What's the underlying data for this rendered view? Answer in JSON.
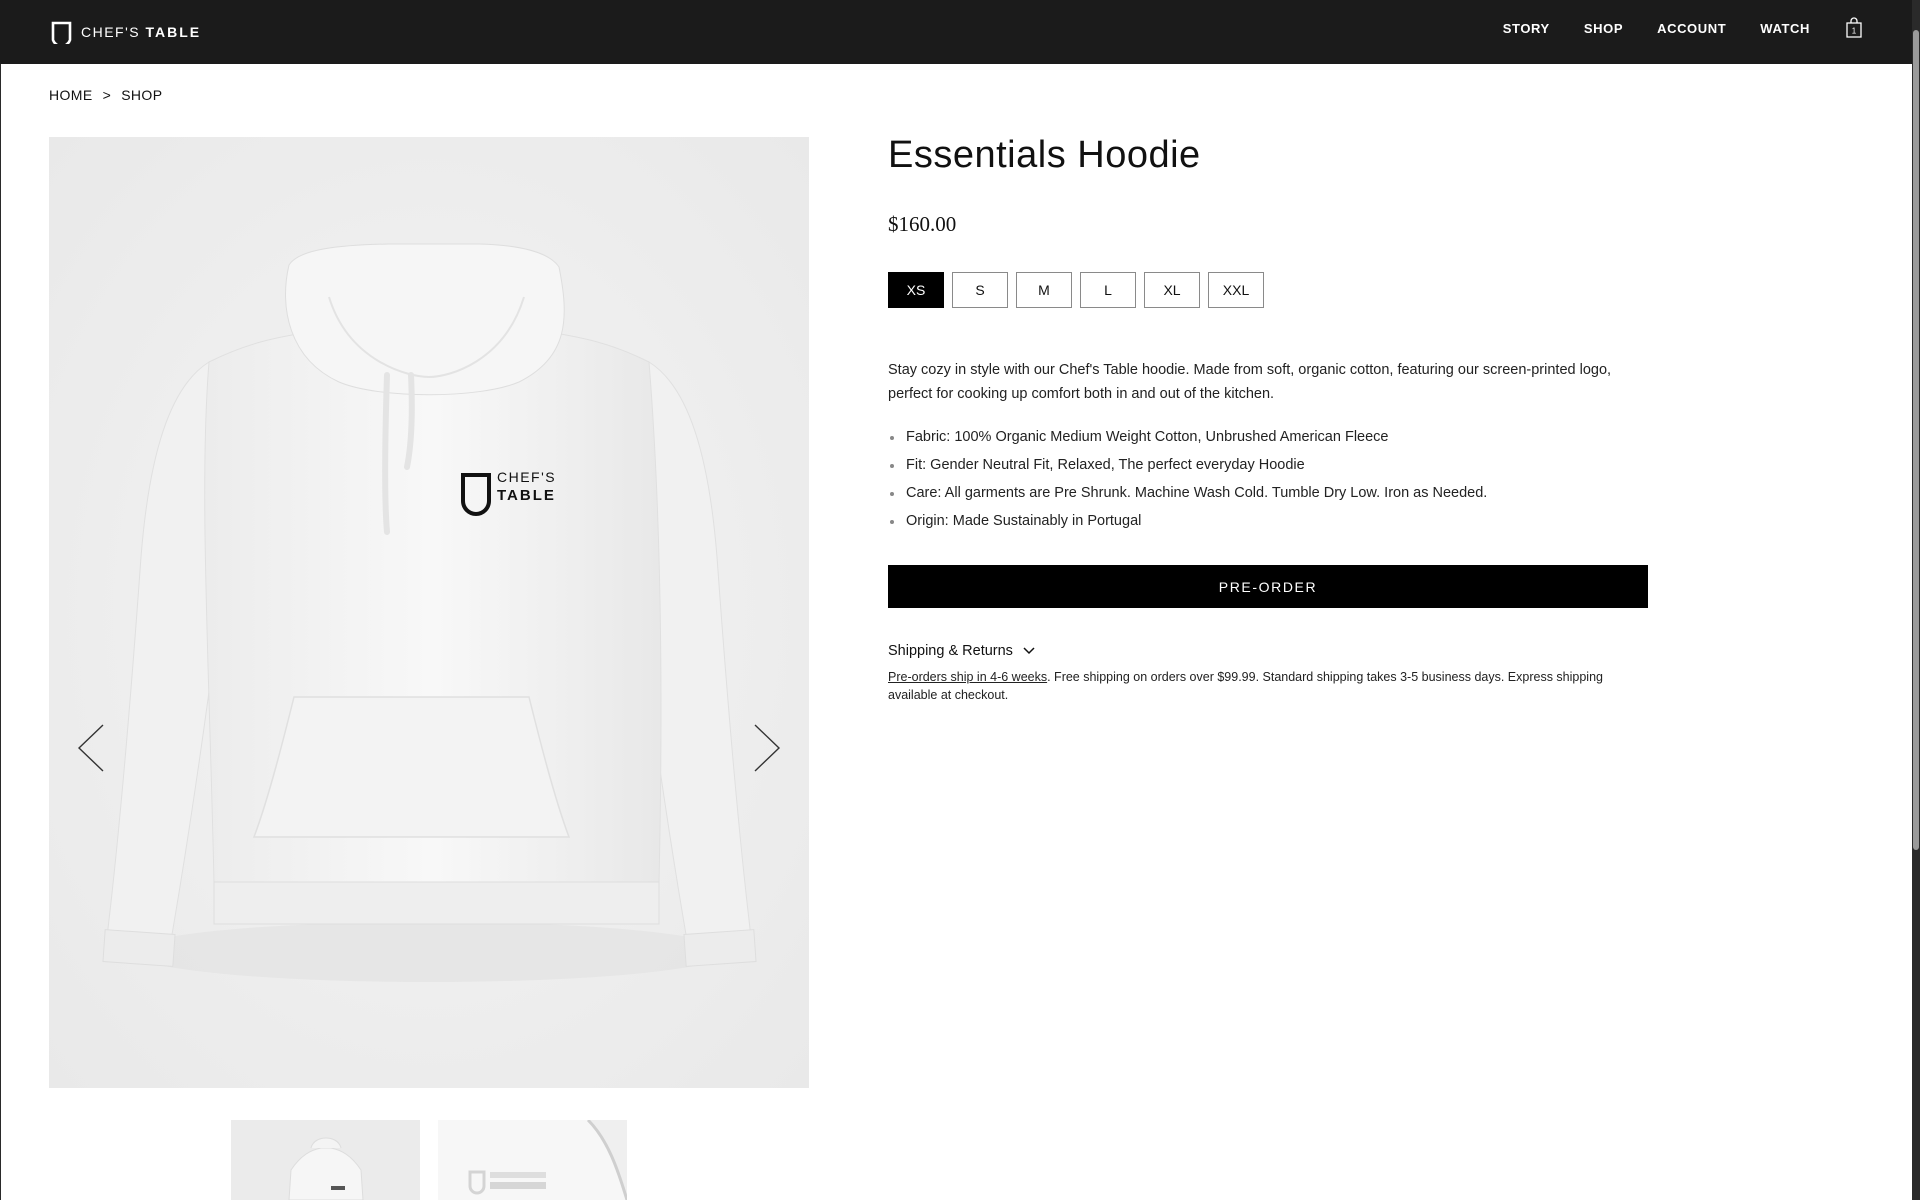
{
  "brand": {
    "name_part1": "CHEF'S",
    "name_part2": "TABLE",
    "logo_icon": "square-ring-logo"
  },
  "nav": {
    "items": [
      {
        "label": "STORY"
      },
      {
        "label": "SHOP"
      },
      {
        "label": "ACCOUNT"
      },
      {
        "label": "WATCH"
      }
    ],
    "cart_icon": "shopping-bag-icon",
    "cart_count": "1"
  },
  "breadcrumb": {
    "items": [
      "HOME",
      "SHOP"
    ],
    "separator": ">"
  },
  "gallery": {
    "image_icon": "hoodie-product-image",
    "print_line1": "CHEF'S",
    "print_line2": "TABLE",
    "prev_icon": "chevron-left-icon",
    "next_icon": "chevron-right-icon",
    "thumbnail_count": 2
  },
  "product": {
    "title": "Essentials Hoodie",
    "price": "$160.00",
    "sizes": [
      "XS",
      "S",
      "M",
      "L",
      "XL",
      "XXL"
    ],
    "selected_size": "XS",
    "description": "Stay cozy in style with our Chef's Table hoodie. Made from soft, organic cotton, featuring our screen-printed logo, perfect for cooking up comfort both in and out of the kitchen.",
    "details": [
      "Fabric: 100% Organic Medium Weight Cotton, Unbrushed American Fleece",
      "Fit: Gender Neutral Fit, Relaxed, The perfect everyday Hoodie",
      "Care: All garments are Pre Shrunk. Machine Wash Cold. Tumble Dry Low. Iron as Needed.",
      "Origin: Made Sustainably in Portugal"
    ],
    "cta_label": "PRE-ORDER"
  },
  "shipping": {
    "toggle_label": "Shipping & Returns",
    "link_text": "Pre-orders ship in 4-6 weeks",
    "rest_text": ". Free shipping on orders over $99.99. Standard shipping takes 3-5 business days. Express shipping available at checkout."
  },
  "colors": {
    "header_bg": "#1b1b1b",
    "accent": "#000000",
    "image_bg": "#efefef"
  }
}
